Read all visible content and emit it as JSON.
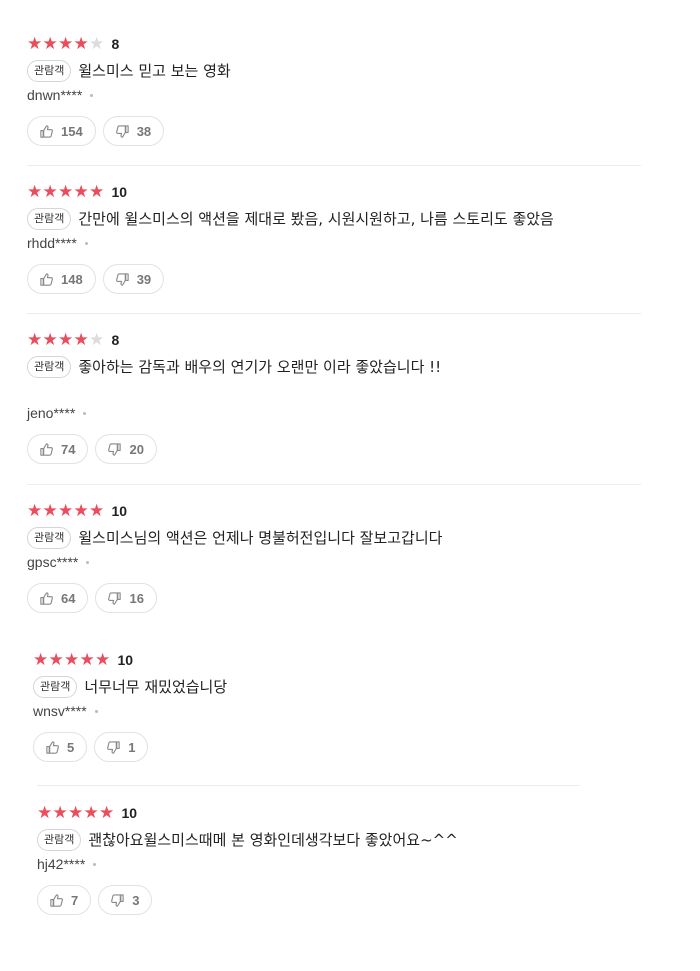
{
  "badge_label": "관람객",
  "colors": {
    "star_on": "#eb4d5c",
    "star_off": "#dcdcdc"
  },
  "icons": {
    "like": "thumbs-up-icon",
    "dislike": "thumbs-down-icon",
    "filled_star": "star-icon",
    "empty_star": "star-outline-icon"
  },
  "reviews": [
    {
      "stars": 4,
      "score": "8",
      "text": "윌스미스 믿고 보는 영화",
      "author": "dnwn****",
      "likes": "154",
      "dislikes": "38"
    },
    {
      "stars": 5,
      "score": "10",
      "text": "간만에 윌스미스의 액션을 제대로 봤음, 시원시원하고, 나름 스토리도 좋았음",
      "author": "rhdd****",
      "likes": "148",
      "dislikes": "39"
    },
    {
      "stars": 4,
      "score": "8",
      "text": "좋아하는 감독과 배우의 연기가 오랜만 이라 좋았습니다 !!",
      "author": "jeno****",
      "likes": "74",
      "dislikes": "20"
    },
    {
      "stars": 5,
      "score": "10",
      "text": "윌스미스님의 액션은 언제나 명불허전입니다 잘보고갑니다",
      "author": "gpsc****",
      "likes": "64",
      "dislikes": "16"
    },
    {
      "stars": 5,
      "score": "10",
      "text": "너무너무 재밌었습니당",
      "author": "wnsv****",
      "likes": "5",
      "dislikes": "1"
    },
    {
      "stars": 5,
      "score": "10",
      "text": "괜찮아요윌스미스때메 본 영화인데생각보다 좋았어요~^^",
      "author": "hj42****",
      "likes": "7",
      "dislikes": "3"
    }
  ]
}
